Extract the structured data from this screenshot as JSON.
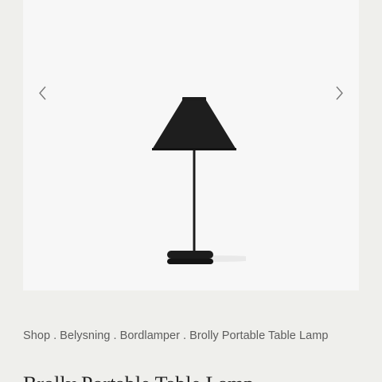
{
  "gallery": {
    "prev_icon": "chevron-left-icon",
    "next_icon": "chevron-right-icon",
    "image_subject": "black-cone-table-lamp"
  },
  "breadcrumb": {
    "items": [
      "Shop",
      "Belysning",
      "Bordlamper",
      "Brolly Portable Table Lamp"
    ],
    "separator": "."
  },
  "product": {
    "title": "Brolly Portable Table Lamp"
  },
  "colors": {
    "page_background": "#efefec",
    "gallery_background": "#f7f7f7",
    "lamp": "#1c1c1c",
    "text": "#5d5d5d"
  }
}
